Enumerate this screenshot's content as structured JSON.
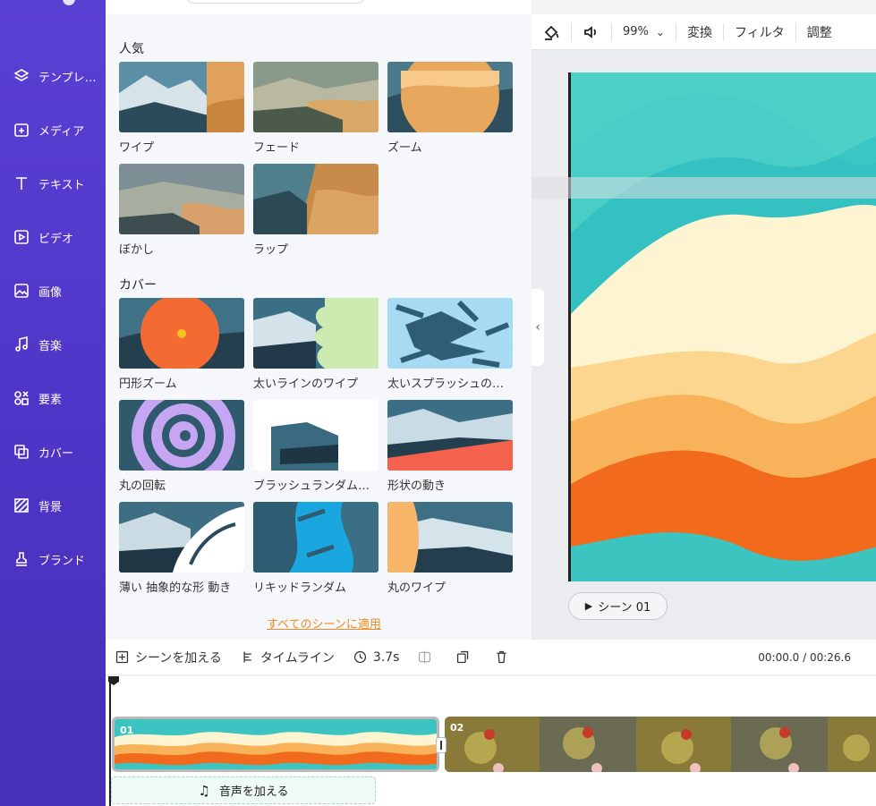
{
  "sidebar": {
    "items": [
      {
        "label": "テンプレート",
        "icon": "layers-icon"
      },
      {
        "label": "メディア",
        "icon": "media-add-icon"
      },
      {
        "label": "テキスト",
        "icon": "text-icon"
      },
      {
        "label": "ビデオ",
        "icon": "video-icon"
      },
      {
        "label": "画像",
        "icon": "image-icon"
      },
      {
        "label": "音楽",
        "icon": "music-icon"
      },
      {
        "label": "要素",
        "icon": "elements-icon"
      },
      {
        "label": "カバー",
        "icon": "cover-icon"
      },
      {
        "label": "背景",
        "icon": "background-icon"
      },
      {
        "label": "ブランド",
        "icon": "brand-stamp-icon"
      }
    ]
  },
  "transitions": {
    "popular_title": "人気",
    "popular": [
      {
        "label": "ワイプ"
      },
      {
        "label": "フェード"
      },
      {
        "label": "ズーム"
      },
      {
        "label": "ぼかし"
      },
      {
        "label": "ラップ"
      }
    ],
    "cover_title": "カバー",
    "cover": [
      {
        "label": "円形ズーム"
      },
      {
        "label": "太いラインのワイプ"
      },
      {
        "label": "太いスプラッシュの回転"
      },
      {
        "label": "丸の回転"
      },
      {
        "label": "ブラッシュランダムモーション"
      },
      {
        "label": "形状の動き"
      },
      {
        "label": "薄い 抽象的な形 動き"
      },
      {
        "label": "リキッドランダム"
      },
      {
        "label": "丸のワイプ"
      }
    ],
    "apply_all": "すべてのシーンに適用"
  },
  "toolbar": {
    "zoom": "99%",
    "transform": "変換",
    "filter": "フィルタ",
    "adjust": "調整"
  },
  "preview": {
    "scene_button": "シーン 01"
  },
  "bottombar": {
    "add_scene": "シーンを加える",
    "timeline": "タイムライン",
    "duration": "3.7s",
    "timecode": "00:00.0 / 00:26.6"
  },
  "timeline": {
    "clip1_num": "01",
    "clip2_num": "02",
    "add_audio": "音声を加える"
  },
  "colors": {
    "sidebar": "#5a3fd3",
    "accent_link": "#f08a1c",
    "teal": "#3cc4c0",
    "cream": "#fdf4d2",
    "orange": "#f26a1b"
  }
}
